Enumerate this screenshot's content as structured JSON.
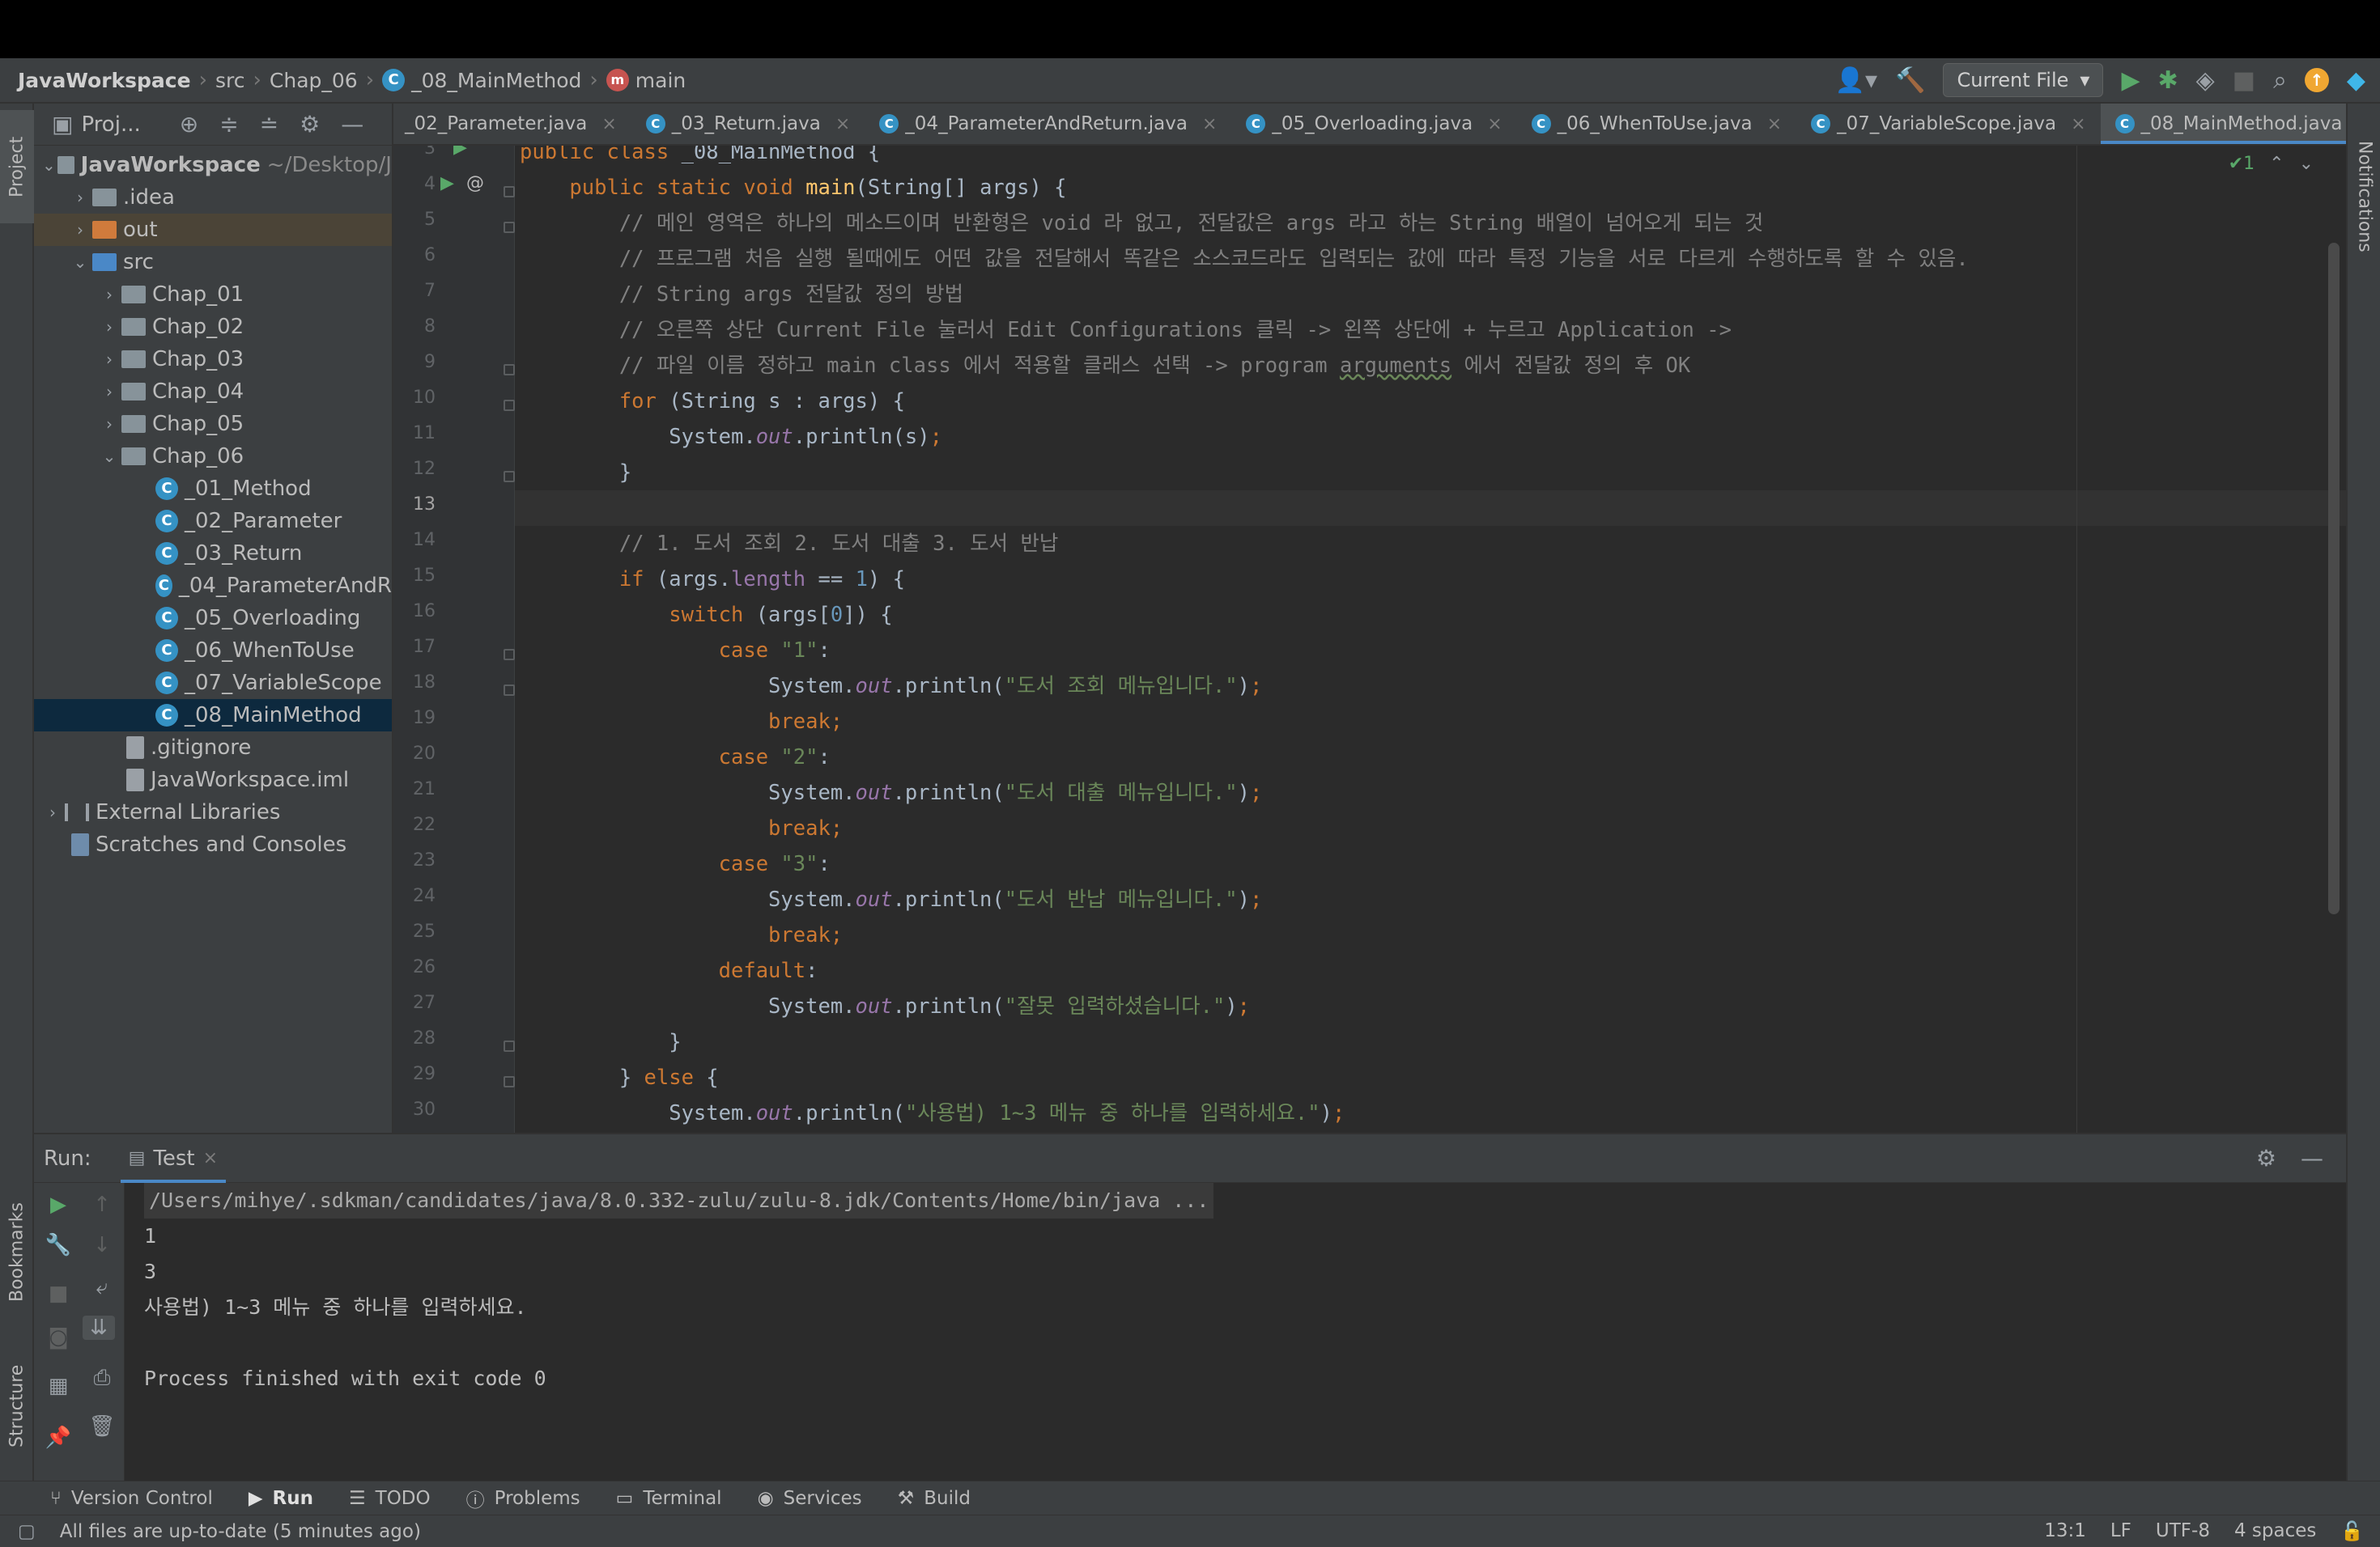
{
  "breadcrumb": {
    "items": [
      "JavaWorkspace",
      "src",
      "Chap_06",
      "_08_MainMethod",
      "main"
    ]
  },
  "toolbar": {
    "run_config": "Current File"
  },
  "project_panel": {
    "title": "Proj...",
    "tree": [
      {
        "label": "JavaWorkspace",
        "hint": "~/Desktop/J"
      },
      {
        "label": ".idea"
      },
      {
        "label": "out"
      },
      {
        "label": "src"
      },
      {
        "label": "Chap_01"
      },
      {
        "label": "Chap_02"
      },
      {
        "label": "Chap_03"
      },
      {
        "label": "Chap_04"
      },
      {
        "label": "Chap_05"
      },
      {
        "label": "Chap_06"
      },
      {
        "label": "_01_Method"
      },
      {
        "label": "_02_Parameter"
      },
      {
        "label": "_03_Return"
      },
      {
        "label": "_04_ParameterAndR"
      },
      {
        "label": "_05_Overloading"
      },
      {
        "label": "_06_WhenToUse"
      },
      {
        "label": "_07_VariableScope"
      },
      {
        "label": "_08_MainMethod"
      },
      {
        "label": ".gitignore"
      },
      {
        "label": "JavaWorkspace.iml"
      },
      {
        "label": "External Libraries"
      },
      {
        "label": "Scratches and Consoles"
      }
    ]
  },
  "editor_tabs": [
    "_02_Parameter.java",
    "_03_Return.java",
    "_04_ParameterAndReturn.java",
    "_05_Overloading.java",
    "_06_WhenToUse.java",
    "_07_VariableScope.java",
    "_08_MainMethod.java"
  ],
  "inspection": {
    "count": "1"
  },
  "code": {
    "line_numbers": [
      "3",
      "4",
      "5",
      "6",
      "7",
      "8",
      "9",
      "10",
      "11",
      "12",
      "13",
      "14",
      "15",
      "16",
      "17",
      "18",
      "19",
      "20",
      "21",
      "22",
      "23",
      "24",
      "25",
      "26",
      "27",
      "28",
      "29",
      "30"
    ],
    "c5": "// 메인 영역은 하나의 메소드이며 반환형은 void 라 없고, 전달값은 args 라고 하는 String 배열이 넘어오게 되는 것",
    "c6": "// 프로그램 처음 실행 될때에도 어떤 값을 전달해서 똑같은 소스코드라도 입력되는 값에 따라 특정 기능을 서로 다르게 수행하도록 할 수 있음.",
    "c7": "// String args 전달값 정의 방법",
    "c8": "// 오른쪽 상단 Current File 눌러서 Edit Configurations 클릭 -> 왼쪽 상단에 + 누르고 Application ->",
    "c9a": "// 파일 이름 정하고 main class 에서 적용할 클래스 선택 -> program ",
    "c9b": "arguments",
    "c9c": " 에서 전달값 정의 후 OK",
    "c14": "// 1. 도서 조회 2. 도서 대출 3. 도서 반납",
    "s18": "\"도서 조회 메뉴입니다.\"",
    "s21": "\"도서 대출 메뉴입니다.\"",
    "s24": "\"도서 반납 메뉴입니다.\"",
    "s27": "\"잘못 입력하셨습니다.\"",
    "s30": "\"사용법) 1~3 메뉴 중 하나를 입력하세요.\"",
    "case1": "\"1\"",
    "case2": "\"2\"",
    "case3": "\"3\""
  },
  "run_panel": {
    "label": "Run:",
    "tab": "Test",
    "console": [
      "/Users/mihye/.sdkman/candidates/java/8.0.332-zulu/zulu-8.jdk/Contents/Home/bin/java ...",
      "1",
      "3",
      "사용법) 1~3 메뉴 중 하나를 입력하세요.",
      "",
      "Process finished with exit code 0"
    ]
  },
  "side_tabs": {
    "project": "Project",
    "bookmarks": "Bookmarks",
    "structure": "Structure",
    "notifications": "Notifications"
  },
  "tool_windows": [
    "Version Control",
    "Run",
    "TODO",
    "Problems",
    "Terminal",
    "Services",
    "Build"
  ],
  "status_bar": {
    "message": "All files are up-to-date (5 minutes ago)",
    "position": "13:1",
    "line_sep": "LF",
    "encoding": "UTF-8",
    "indent": "4 spaces"
  }
}
